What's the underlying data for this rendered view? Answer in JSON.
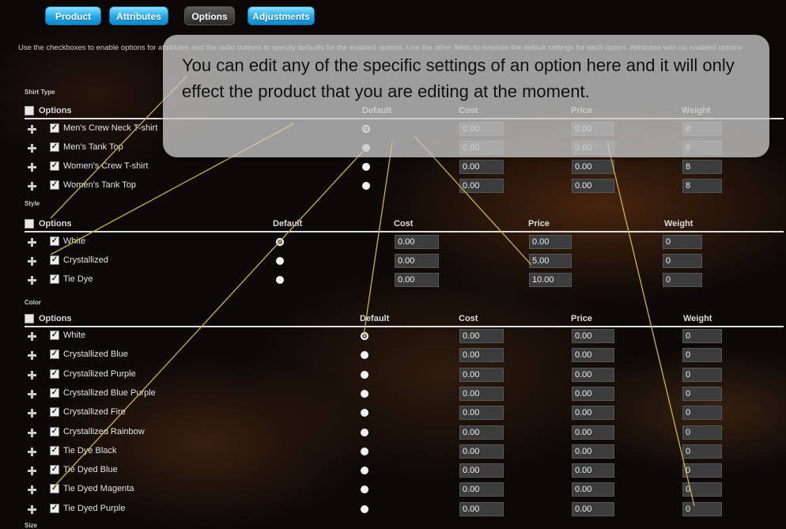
{
  "tabs": [
    {
      "label": "Product"
    },
    {
      "label": "Attributes"
    },
    {
      "label": "Options",
      "active": true
    },
    {
      "label": "Adjustments"
    }
  ],
  "intro_text": "Use the checkboxes to enable options for attributes and the radio buttons to specify defaults for the enabled options. Use the other fields to override the default settings for each option. Attributes with no enabled options",
  "callout_text": "You can edit any of the specific settings of an option here and it will only effect the product that you are editing at the moment.",
  "options_label": "Options",
  "columns": {
    "default": "Default",
    "cost": "Cost",
    "price": "Price",
    "weight": "Weight"
  },
  "sections": [
    {
      "name": "Shirt Type",
      "rows": [
        {
          "label": "Men's Crew Neck T-shirt",
          "cost": "0.00",
          "price": "0.00",
          "weight": "8",
          "default": true
        },
        {
          "label": "Men's Tank Top",
          "cost": "0.00",
          "price": "0.00",
          "weight": "8",
          "default": false
        },
        {
          "label": "Women's Crew T-shirt",
          "cost": "0.00",
          "price": "0.00",
          "weight": "8",
          "default": false
        },
        {
          "label": "Women's Tank Top",
          "cost": "0.00",
          "price": "0.00",
          "weight": "8",
          "default": false
        }
      ]
    },
    {
      "name": "Style",
      "rows": [
        {
          "label": "White",
          "cost": "0.00",
          "price": "0.00",
          "weight": "0",
          "default": true
        },
        {
          "label": "Crystallized",
          "cost": "0.00",
          "price": "5.00",
          "weight": "0",
          "default": false
        },
        {
          "label": "Tie Dye",
          "cost": "0.00",
          "price": "10.00",
          "weight": "0",
          "default": false
        }
      ]
    },
    {
      "name": "Color",
      "rows": [
        {
          "label": "White",
          "cost": "0.00",
          "price": "0.00",
          "weight": "0",
          "default": true
        },
        {
          "label": "Crystallized Blue",
          "cost": "0.00",
          "price": "0.00",
          "weight": "0",
          "default": false
        },
        {
          "label": "Crystallized Purple",
          "cost": "0.00",
          "price": "0.00",
          "weight": "0",
          "default": false
        },
        {
          "label": "Crystallized Blue Purple",
          "cost": "0.00",
          "price": "0.00",
          "weight": "0",
          "default": false
        },
        {
          "label": "Crystallized Fire",
          "cost": "0.00",
          "price": "0.00",
          "weight": "0",
          "default": false
        },
        {
          "label": "Crystallized Rainbow",
          "cost": "0.00",
          "price": "0.00",
          "weight": "0",
          "default": false
        },
        {
          "label": "Tie Dye Black",
          "cost": "0.00",
          "price": "0.00",
          "weight": "0",
          "default": false
        },
        {
          "label": "Tie Dyed Blue",
          "cost": "0.00",
          "price": "0.00",
          "weight": "0",
          "default": false
        },
        {
          "label": "Tie Dyed Magenta",
          "cost": "0.00",
          "price": "0.00",
          "weight": "0",
          "default": false
        },
        {
          "label": "Tie Dyed Purple",
          "cost": "0.00",
          "price": "0.00",
          "weight": "0",
          "default": false
        }
      ]
    }
  ],
  "next_section_label": "Size",
  "icons": {
    "expand": "plus-icon",
    "checked": "checkbox-icon"
  },
  "colors": {
    "tab_blue": "#1fa8e8",
    "callout_bg": "#c8c8c8",
    "pointer_line": "#c9b44a"
  }
}
